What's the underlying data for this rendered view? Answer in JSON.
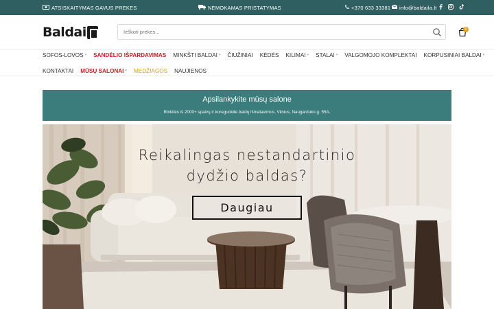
{
  "topbar": {
    "payment": "ATSISKAITYMAS GAVUS PREKES",
    "shipping": "NEMOKAMAS PRISTATYMAS",
    "phone": "+370 633 33381",
    "email": "info@baldaila.lt",
    "social": [
      "facebook-icon",
      "instagram-icon",
      "tiktok-icon"
    ]
  },
  "header": {
    "logo_text": "Baldai",
    "search_placeholder": "Ieškoti prekes...",
    "cart_count": "0"
  },
  "nav": {
    "row1": [
      {
        "label": "SOFOS-LOVOS",
        "chevron": true,
        "style": "normal"
      },
      {
        "label": "SANDĖLIO IŠPARDAVIMAS",
        "chevron": false,
        "style": "red"
      },
      {
        "label": "MINKŠTI BALDAI",
        "chevron": true,
        "style": "normal"
      },
      {
        "label": "ČIUŽINIAI",
        "chevron": false,
        "style": "normal"
      },
      {
        "label": "KĖDĖS",
        "chevron": false,
        "style": "normal"
      },
      {
        "label": "KILIMAI",
        "chevron": true,
        "style": "normal"
      },
      {
        "label": "STALAI",
        "chevron": true,
        "style": "normal"
      },
      {
        "label": "VALGOMOJO KOMPLEKTAI",
        "chevron": false,
        "style": "normal"
      },
      {
        "label": "KORPUSINIAI BALDAI",
        "chevron": true,
        "style": "normal"
      }
    ],
    "row2": [
      {
        "label": "KONTAKTAI",
        "chevron": false,
        "style": "normal"
      },
      {
        "label": "MŪSŲ SALONAI",
        "chevron": true,
        "style": "red"
      },
      {
        "label": "MEDŽIAGOS",
        "chevron": false,
        "style": "gold"
      },
      {
        "label": "NAUJIENOS",
        "chevron": false,
        "style": "normal"
      }
    ]
  },
  "promo": {
    "title": "Apsilankykite mūsų salone",
    "subtitle": "Rinkitės iš 2000+ spalvų ir koreguokite baldų išmatavimus. Vilnius, Naugarduko g. 55A."
  },
  "hero": {
    "line1": "Reikalingas nestandartinio",
    "line2": "dydžio baldas?",
    "button": "Daugiau"
  },
  "colors": {
    "topbar": "#2f5f60",
    "promo": "#3a7d7c",
    "accent_red": "#c0222b",
    "accent_gold": "#c9a227"
  }
}
